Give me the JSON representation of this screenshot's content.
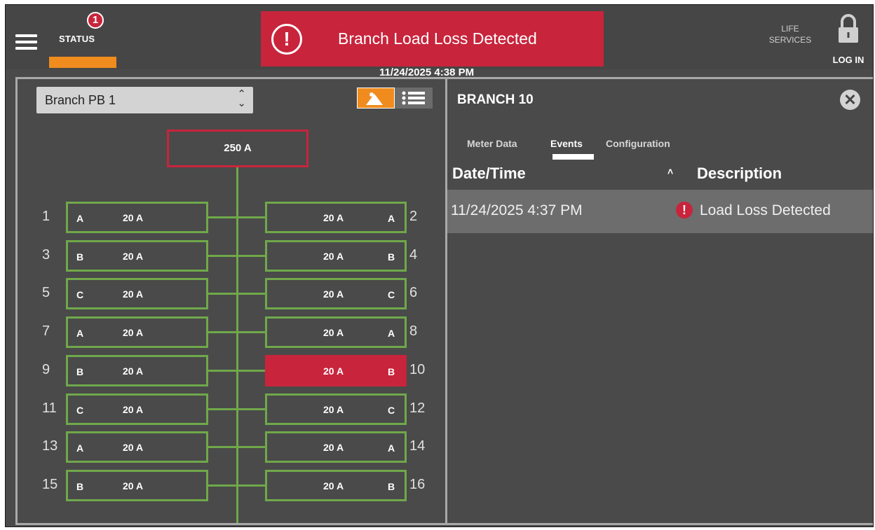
{
  "topbar": {
    "status_label": "STATUS",
    "status_badge_count": "1",
    "alarm_text": "Branch Load Loss Detected",
    "alarm_icon": "!",
    "timestamp": "11/24/2025 4:38 PM",
    "life_services_label": "LIFE SERVICES",
    "login_label": "LOG IN"
  },
  "left_panel": {
    "selected_branch": "Branch PB 1",
    "main_breaker": "250 A",
    "view_modes": [
      "diagram",
      "list"
    ],
    "active_view": "diagram",
    "left_breakers": [
      {
        "pos": "1",
        "phase": "A",
        "amps": "20 A"
      },
      {
        "pos": "3",
        "phase": "B",
        "amps": "20 A"
      },
      {
        "pos": "5",
        "phase": "C",
        "amps": "20 A"
      },
      {
        "pos": "7",
        "phase": "A",
        "amps": "20 A"
      },
      {
        "pos": "9",
        "phase": "B",
        "amps": "20 A"
      },
      {
        "pos": "11",
        "phase": "C",
        "amps": "20 A"
      },
      {
        "pos": "13",
        "phase": "A",
        "amps": "20 A"
      },
      {
        "pos": "15",
        "phase": "B",
        "amps": "20 A"
      }
    ],
    "right_breakers": [
      {
        "pos": "2",
        "phase": "A",
        "amps": "20 A",
        "alarm": false
      },
      {
        "pos": "4",
        "phase": "B",
        "amps": "20 A",
        "alarm": false
      },
      {
        "pos": "6",
        "phase": "C",
        "amps": "20 A",
        "alarm": false
      },
      {
        "pos": "8",
        "phase": "A",
        "amps": "20 A",
        "alarm": false
      },
      {
        "pos": "10",
        "phase": "B",
        "amps": "20 A",
        "alarm": true
      },
      {
        "pos": "12",
        "phase": "C",
        "amps": "20 A",
        "alarm": false
      },
      {
        "pos": "14",
        "phase": "A",
        "amps": "20 A",
        "alarm": false
      },
      {
        "pos": "16",
        "phase": "B",
        "amps": "20 A",
        "alarm": false
      }
    ]
  },
  "right_panel": {
    "title": "BRANCH 10",
    "tabs": [
      {
        "label": "Meter Data",
        "active": false
      },
      {
        "label": "Events",
        "active": true
      },
      {
        "label": "Configuration",
        "active": false
      }
    ],
    "columns": {
      "date": "Date/Time",
      "description": "Description"
    },
    "events": [
      {
        "datetime": "11/24/2025 4:37 PM",
        "description": "Load Loss Detected",
        "severity_icon": "!"
      }
    ]
  },
  "colors": {
    "alarm_red": "#c8243c",
    "accent_orange": "#f08c1e",
    "breaker_green": "#6fa84a",
    "panel_bg": "#4a4a4a"
  }
}
